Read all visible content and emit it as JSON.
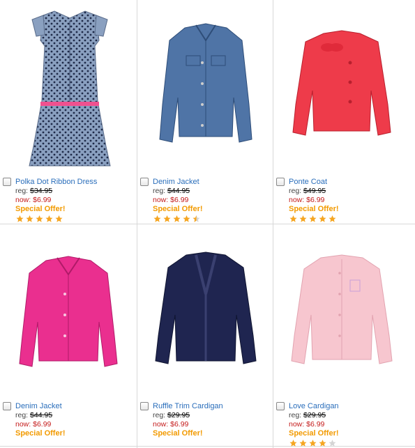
{
  "products": [
    {
      "name": "Polka Dot Ribbon Dress",
      "reg_label": "reg:",
      "reg_price": "$34.95",
      "now_label": "now:",
      "now_price": "$6.99",
      "offer": "Special Offer!",
      "rating": 5,
      "color": "#7b8fb0"
    },
    {
      "name": "Denim Jacket",
      "reg_label": "reg:",
      "reg_price": "$44.95",
      "now_label": "now:",
      "now_price": "$6.99",
      "offer": "Special Offer!",
      "rating": 4.5,
      "color": "#4f74a6"
    },
    {
      "name": "Ponte Coat",
      "reg_label": "reg:",
      "reg_price": "$49.95",
      "now_label": "now:",
      "now_price": "$6.99",
      "offer": "Special Offer!",
      "rating": 5,
      "color": "#ee3b4a"
    },
    {
      "name": "Denim Jacket",
      "reg_label": "reg:",
      "reg_price": "$44.95",
      "now_label": "now:",
      "now_price": "$6.99",
      "offer": "Special Offer!",
      "rating": 0,
      "color": "#ea2f8f"
    },
    {
      "name": "Ruffle Trim Cardigan",
      "reg_label": "reg:",
      "reg_price": "$29.95",
      "now_label": "now:",
      "now_price": "$6.99",
      "offer": "Special Offer!",
      "rating": 0,
      "color": "#1f2550"
    },
    {
      "name": "Love Cardigan",
      "reg_label": "reg:",
      "reg_price": "$29.95",
      "now_label": "now:",
      "now_price": "$6.99",
      "offer": "Special Offer!",
      "rating": 4,
      "color": "#f7c6cf"
    }
  ],
  "colors": {
    "link": "#2a6ebb",
    "sale": "#c41a1a",
    "offer": "#f29a00",
    "star": "#f5a623",
    "star_empty": "#d5d5d5"
  }
}
